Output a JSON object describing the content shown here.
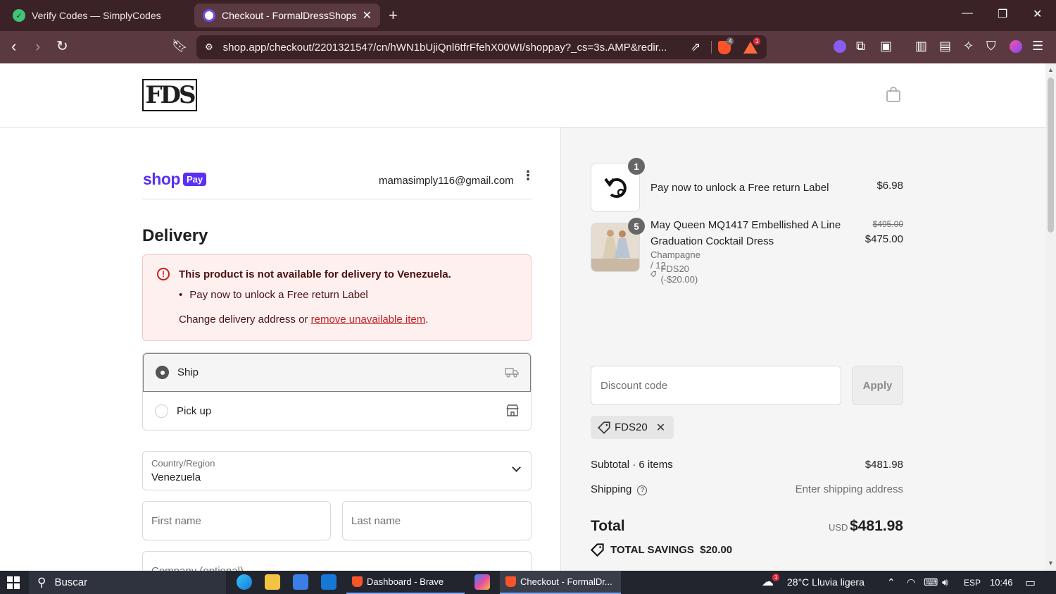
{
  "browser": {
    "tabs": [
      {
        "title": "Verify Codes — SimplyCodes",
        "active": false
      },
      {
        "title": "Checkout - FormalDressShops.com",
        "active": true
      }
    ],
    "url": "shop.app/checkout/2201321547/cn/hWN1bUjiQnl6tfrFfehX00WI/shoppay?_cs=3s.AMP&redir...",
    "brave_shield_count": "4",
    "rewards_count": "1"
  },
  "store": {
    "logo_text": "FDS"
  },
  "checkout": {
    "shop_word": "shop",
    "pay_word": "Pay",
    "email": "mamasimply116@gmail.com",
    "delivery_title": "Delivery",
    "alert": {
      "title": "This product is not available for delivery to Venezuela.",
      "item": "Pay now to unlock a Free return Label",
      "change_prefix": "Change delivery address or ",
      "change_link": "remove unavailable item",
      "change_suffix": "."
    },
    "options": {
      "ship": "Ship",
      "pickup": "Pick up"
    },
    "country_label": "Country/Region",
    "country_value": "Venezuela",
    "first_name": "First name",
    "last_name": "Last name",
    "company": "Company (optional)"
  },
  "order": {
    "items": [
      {
        "qty": "1",
        "name": "Pay now to unlock a Free return Label",
        "price": "$6.98"
      },
      {
        "qty": "5",
        "name": "May Queen MQ1417 Embellished A Line Graduation Cocktail Dress",
        "original_price": "$495.00",
        "price": "$475.00",
        "variant": "Champagne / 12",
        "discount": "FDS20 (-$20.00)"
      }
    ],
    "discount_placeholder": "Discount code",
    "apply_label": "Apply",
    "applied_code": "FDS20",
    "subtotal_label": "Subtotal · 6 items",
    "subtotal_value": "$481.98",
    "shipping_label": "Shipping",
    "shipping_value": "Enter shipping address",
    "total_label": "Total",
    "currency": "USD",
    "total_value": "$481.98",
    "savings_label": "TOTAL SAVINGS",
    "savings_value": "$20.00"
  },
  "taskbar": {
    "search": "Buscar",
    "task1": "Dashboard - Brave",
    "task2": "Checkout - FormalDr...",
    "weather": "28°C  Lluvia ligera",
    "lang": "ESP",
    "time": "10:46",
    "weather_badge": "1"
  }
}
